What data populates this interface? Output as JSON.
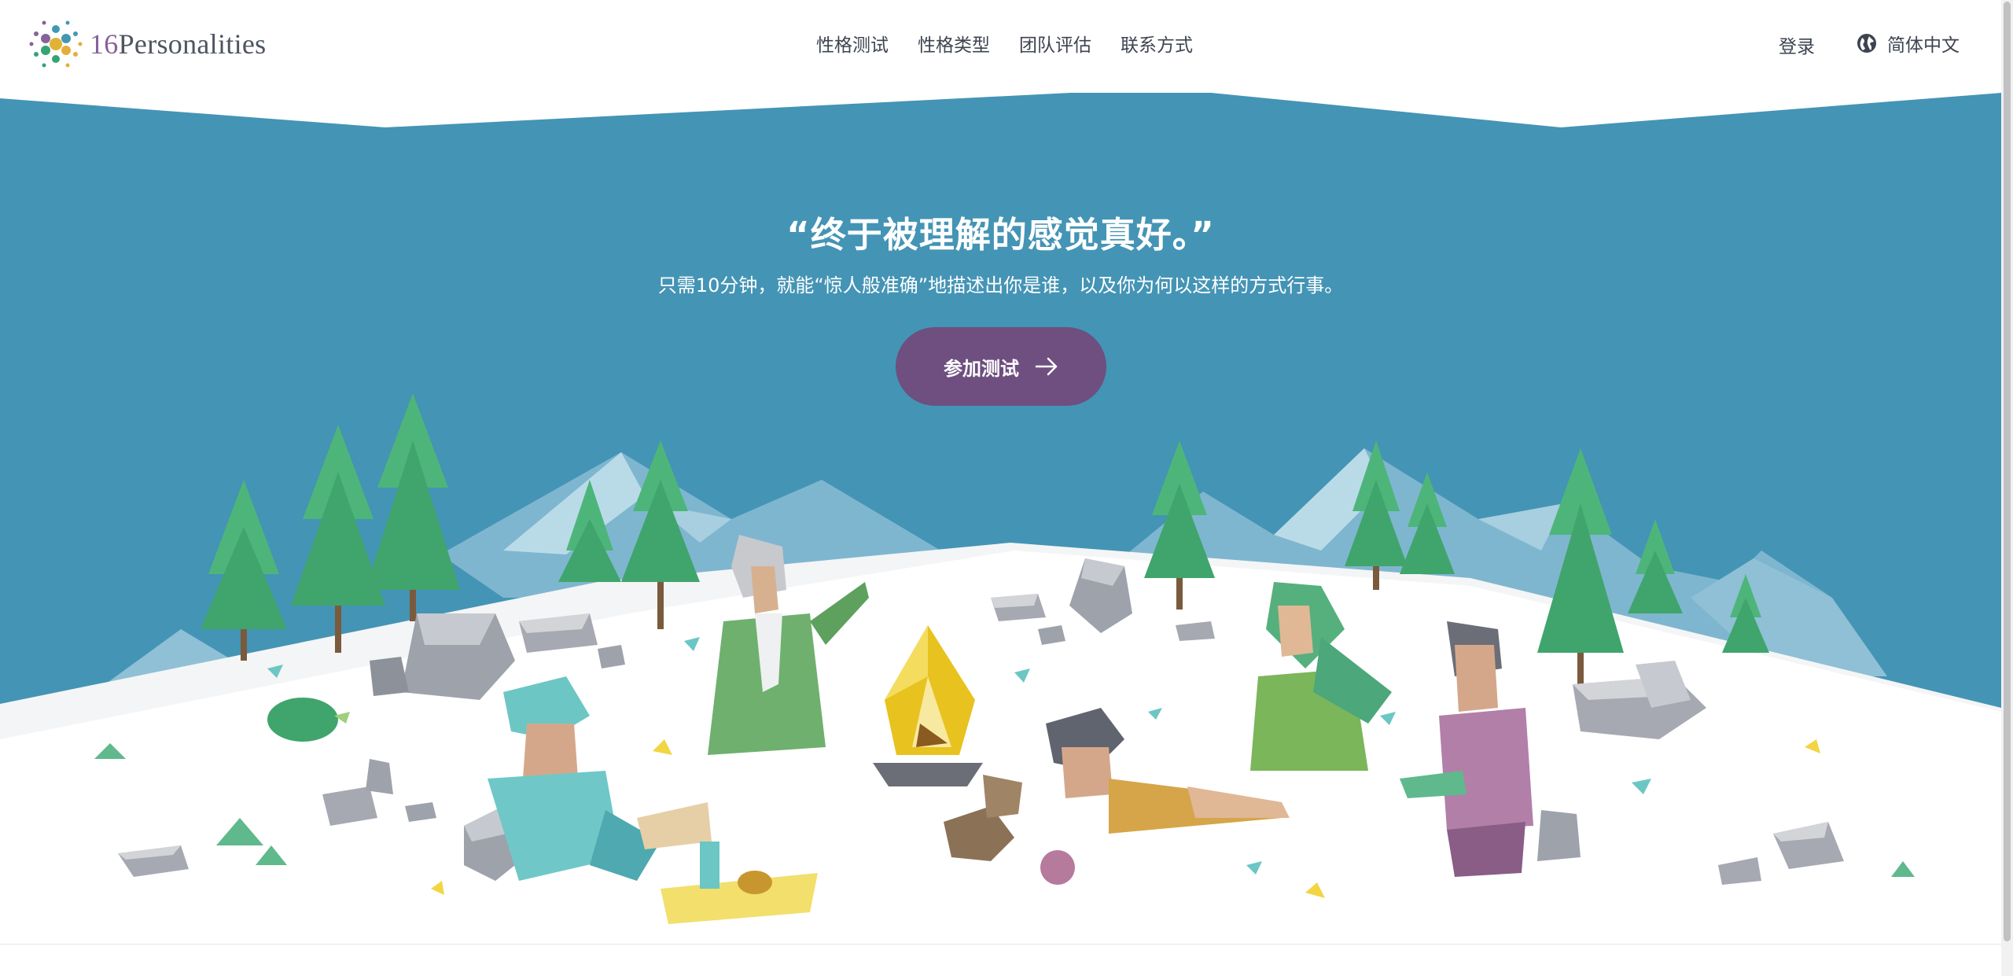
{
  "header": {
    "brand": {
      "number": "16",
      "name": "Personalities"
    },
    "nav": [
      {
        "label": "性格测试"
      },
      {
        "label": "性格类型"
      },
      {
        "label": "团队评估"
      },
      {
        "label": "联系方式"
      }
    ],
    "login_label": "登录",
    "language_label": "简体中文"
  },
  "hero": {
    "headline": "“终于被理解的感觉真好。”",
    "subline": "只需10分钟，就能“惊人般准确”地描述出你是谁，以及你为何以这样的方式行事。",
    "cta_label": "参加测试"
  },
  "colors": {
    "sky": "#4494b5",
    "accent_purple": "#6e4f80",
    "snow": "#f4f5f6",
    "tree_green": "#3fa56c"
  },
  "icons": {
    "logo": "sixteen-dots-logo-icon",
    "globe": "globe-icon",
    "cta_arrow": "arrow-right-icon"
  }
}
